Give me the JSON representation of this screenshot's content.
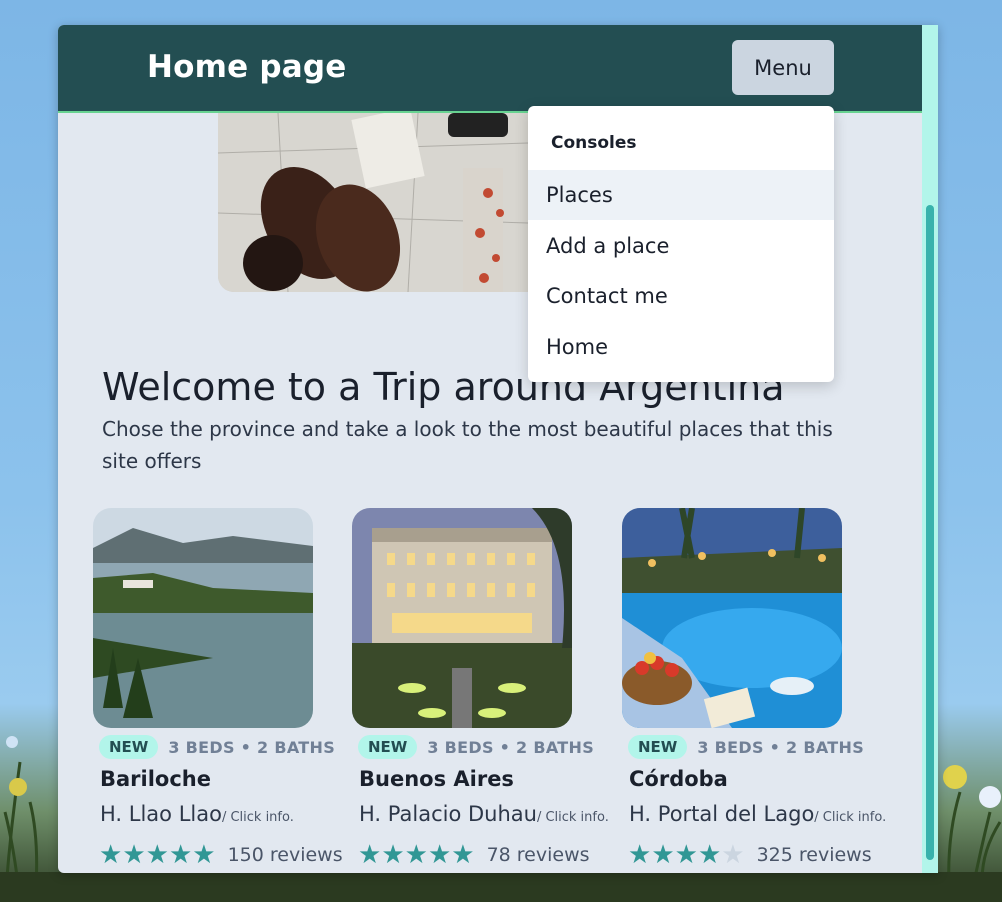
{
  "header": {
    "title": "Home page",
    "menu_label": "Menu"
  },
  "menu": {
    "group_title": "Consoles",
    "items": [
      {
        "label": "Places",
        "highlighted": true
      },
      {
        "label": "Add a place"
      },
      {
        "label": "Contact me"
      },
      {
        "label": "Home"
      }
    ]
  },
  "hero": {
    "image": "travel-boots-map-photo"
  },
  "welcome": {
    "heading": "Welcome to a Trip around Argentina",
    "subtext": "Chose the province and take a look to the most beautiful places that this site offers"
  },
  "cards": [
    {
      "image": "bariloche-lake-photo",
      "badge": "NEW",
      "specs": "3 BEDS • 2 BATHS",
      "name": "Bariloche",
      "hotel": "H. Llao Llao",
      "click": "/ Click info.",
      "rating": 5,
      "reviews": "150 reviews"
    },
    {
      "image": "palacio-duhau-photo",
      "badge": "NEW",
      "specs": "3 BEDS • 2 BATHS",
      "name": "Buenos Aires",
      "hotel": "H. Palacio Duhau",
      "click": "/ Click info.",
      "rating": 5,
      "reviews": "78 reviews"
    },
    {
      "image": "pool-resort-photo",
      "badge": "NEW",
      "specs": "3 BEDS • 2 BATHS",
      "name": "Córdoba",
      "hotel": "H. Portal del Lago",
      "click": "/ Click info.",
      "rating": 4,
      "reviews": "325 reviews"
    }
  ],
  "colors": {
    "header": "#234e52",
    "accent": "#319795",
    "badge_bg": "#b2f5ea",
    "page_bg": "#e2e8f0"
  }
}
